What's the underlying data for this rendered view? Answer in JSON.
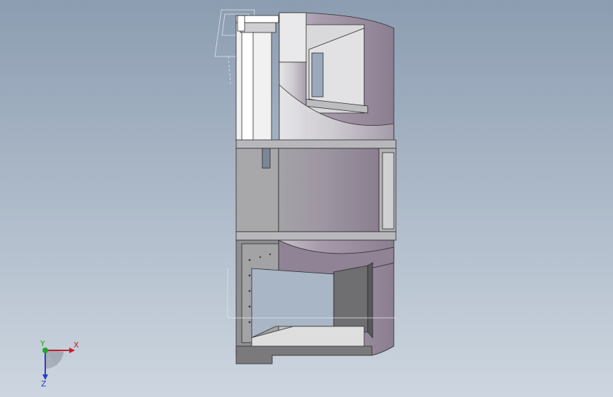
{
  "viewport": {
    "background_top": "#8c9db1",
    "background_bottom": "#cdd6e0"
  },
  "triad": {
    "x_label": "X",
    "y_label": "Y",
    "z_label": "Z",
    "x_color": "#c0202a",
    "y_color": "#1fa82a",
    "z_color": "#2a3ec0"
  },
  "model": {
    "shell_color": "#968a9c",
    "shell_light": "#c9c4cc",
    "face_light": "#dcdcdc",
    "face_dark": "#6c6c6c",
    "edge_color": "#2a2a2a"
  }
}
